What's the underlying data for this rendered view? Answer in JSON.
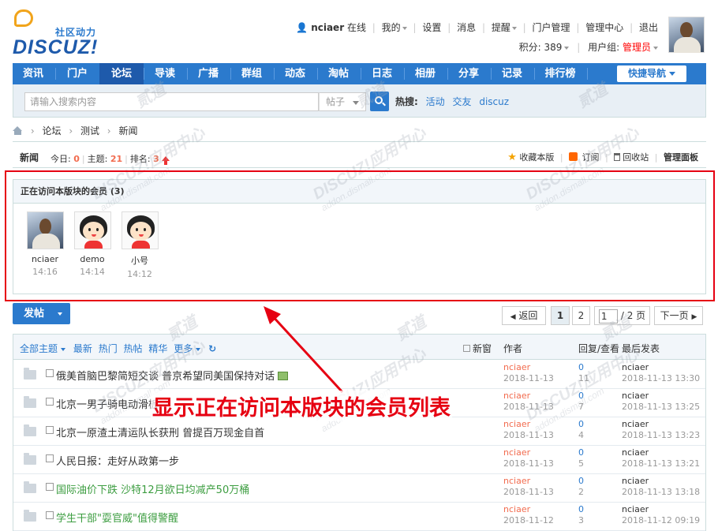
{
  "logo": {
    "slogan": "社区动力",
    "wordmark": "DISCUZ!"
  },
  "userbar": {
    "username": "nciaer",
    "status": "在线",
    "links": [
      "我的",
      "设置",
      "消息",
      "提醒",
      "门户管理",
      "管理中心",
      "退出"
    ],
    "points_label": "积分: 389",
    "usergroup_label": "用户组:",
    "usergroup_value": "管理员"
  },
  "nav": {
    "items": [
      "资讯",
      "门户",
      "论坛",
      "导读",
      "广播",
      "群组",
      "动态",
      "淘帖",
      "日志",
      "相册",
      "分享",
      "记录",
      "排行榜"
    ],
    "active": "论坛",
    "quicknav": "快捷导航"
  },
  "search": {
    "placeholder": "请输入搜索内容",
    "type": "帖子",
    "hot_label": "热搜:",
    "hot_words": [
      "活动",
      "交友",
      "discuz"
    ]
  },
  "breadcrumb": [
    "论坛",
    "测试",
    "新闻"
  ],
  "forum": {
    "name": "新闻",
    "today_label": "今日:",
    "today": "0",
    "threads_label": "主题:",
    "threads": "21",
    "rank_label": "排名:",
    "rank": "3",
    "tools": [
      "收藏本版",
      "订阅",
      "回收站",
      "管理面板"
    ]
  },
  "visitors": {
    "title": "正在访问本版块的会员 (3)",
    "members": [
      {
        "name": "nciaer",
        "time": "14:16",
        "avatar": "photo"
      },
      {
        "name": "demo",
        "time": "14:14",
        "avatar": "cartoon"
      },
      {
        "name": "小号",
        "time": "14:12",
        "avatar": "cartoon"
      }
    ]
  },
  "annotation": "显示正在访问本版块的会员列表",
  "toolbar": {
    "post_button": "发帖",
    "back": "返回",
    "pages": [
      "1",
      "2"
    ],
    "current_page_input": "1",
    "total_pages": "/ 2 页",
    "next": "下一页"
  },
  "threadlist": {
    "filters": [
      "全部主题",
      "最新",
      "热门",
      "热帖",
      "精华",
      "更多"
    ],
    "new_window": "新窗",
    "col_author": "作者",
    "col_replies": "回复/查看",
    "col_last": "最后发表",
    "threads": [
      {
        "subject": "俄美首脑巴黎简短交谈 普京希望同美国保持对话",
        "green": false,
        "image": true,
        "author": "nciaer",
        "date": "2018-11-13",
        "replies": "0",
        "views": "11",
        "last_user": "nciaer",
        "last_time": "2018-11-13 13:30"
      },
      {
        "subject": "北京一男子骑电动滑板",
        "green": false,
        "image": false,
        "author": "nciaer",
        "date": "2018-11-13",
        "replies": "0",
        "views": "7",
        "last_user": "nciaer",
        "last_time": "2018-11-13 13:25"
      },
      {
        "subject": "北京一原渣土清运队长获刑 曾提百万现金自首",
        "green": false,
        "image": false,
        "author": "nciaer",
        "date": "2018-11-13",
        "replies": "0",
        "views": "4",
        "last_user": "nciaer",
        "last_time": "2018-11-13 13:23"
      },
      {
        "subject": "人民日报：走好从政第一步",
        "green": false,
        "image": false,
        "author": "nciaer",
        "date": "2018-11-13",
        "replies": "0",
        "views": "5",
        "last_user": "nciaer",
        "last_time": "2018-11-13 13:21"
      },
      {
        "subject": "国际油价下跌 沙特12月欲日均减产50万桶",
        "green": true,
        "image": false,
        "author": "nciaer",
        "date": "2018-11-13",
        "replies": "0",
        "views": "2",
        "last_user": "nciaer",
        "last_time": "2018-11-13 13:18"
      },
      {
        "subject": "学生干部\"耍官威\"值得警醒",
        "green": true,
        "image": false,
        "author": "nciaer",
        "date": "2018-11-12",
        "replies": "0",
        "views": "3",
        "last_user": "nciaer",
        "last_time": "2018-11-12 09:19"
      }
    ]
  },
  "watermark": {
    "brand": "DISCUZ!应用中心",
    "site": "addon.dismall.com",
    "mark": "贰道"
  }
}
